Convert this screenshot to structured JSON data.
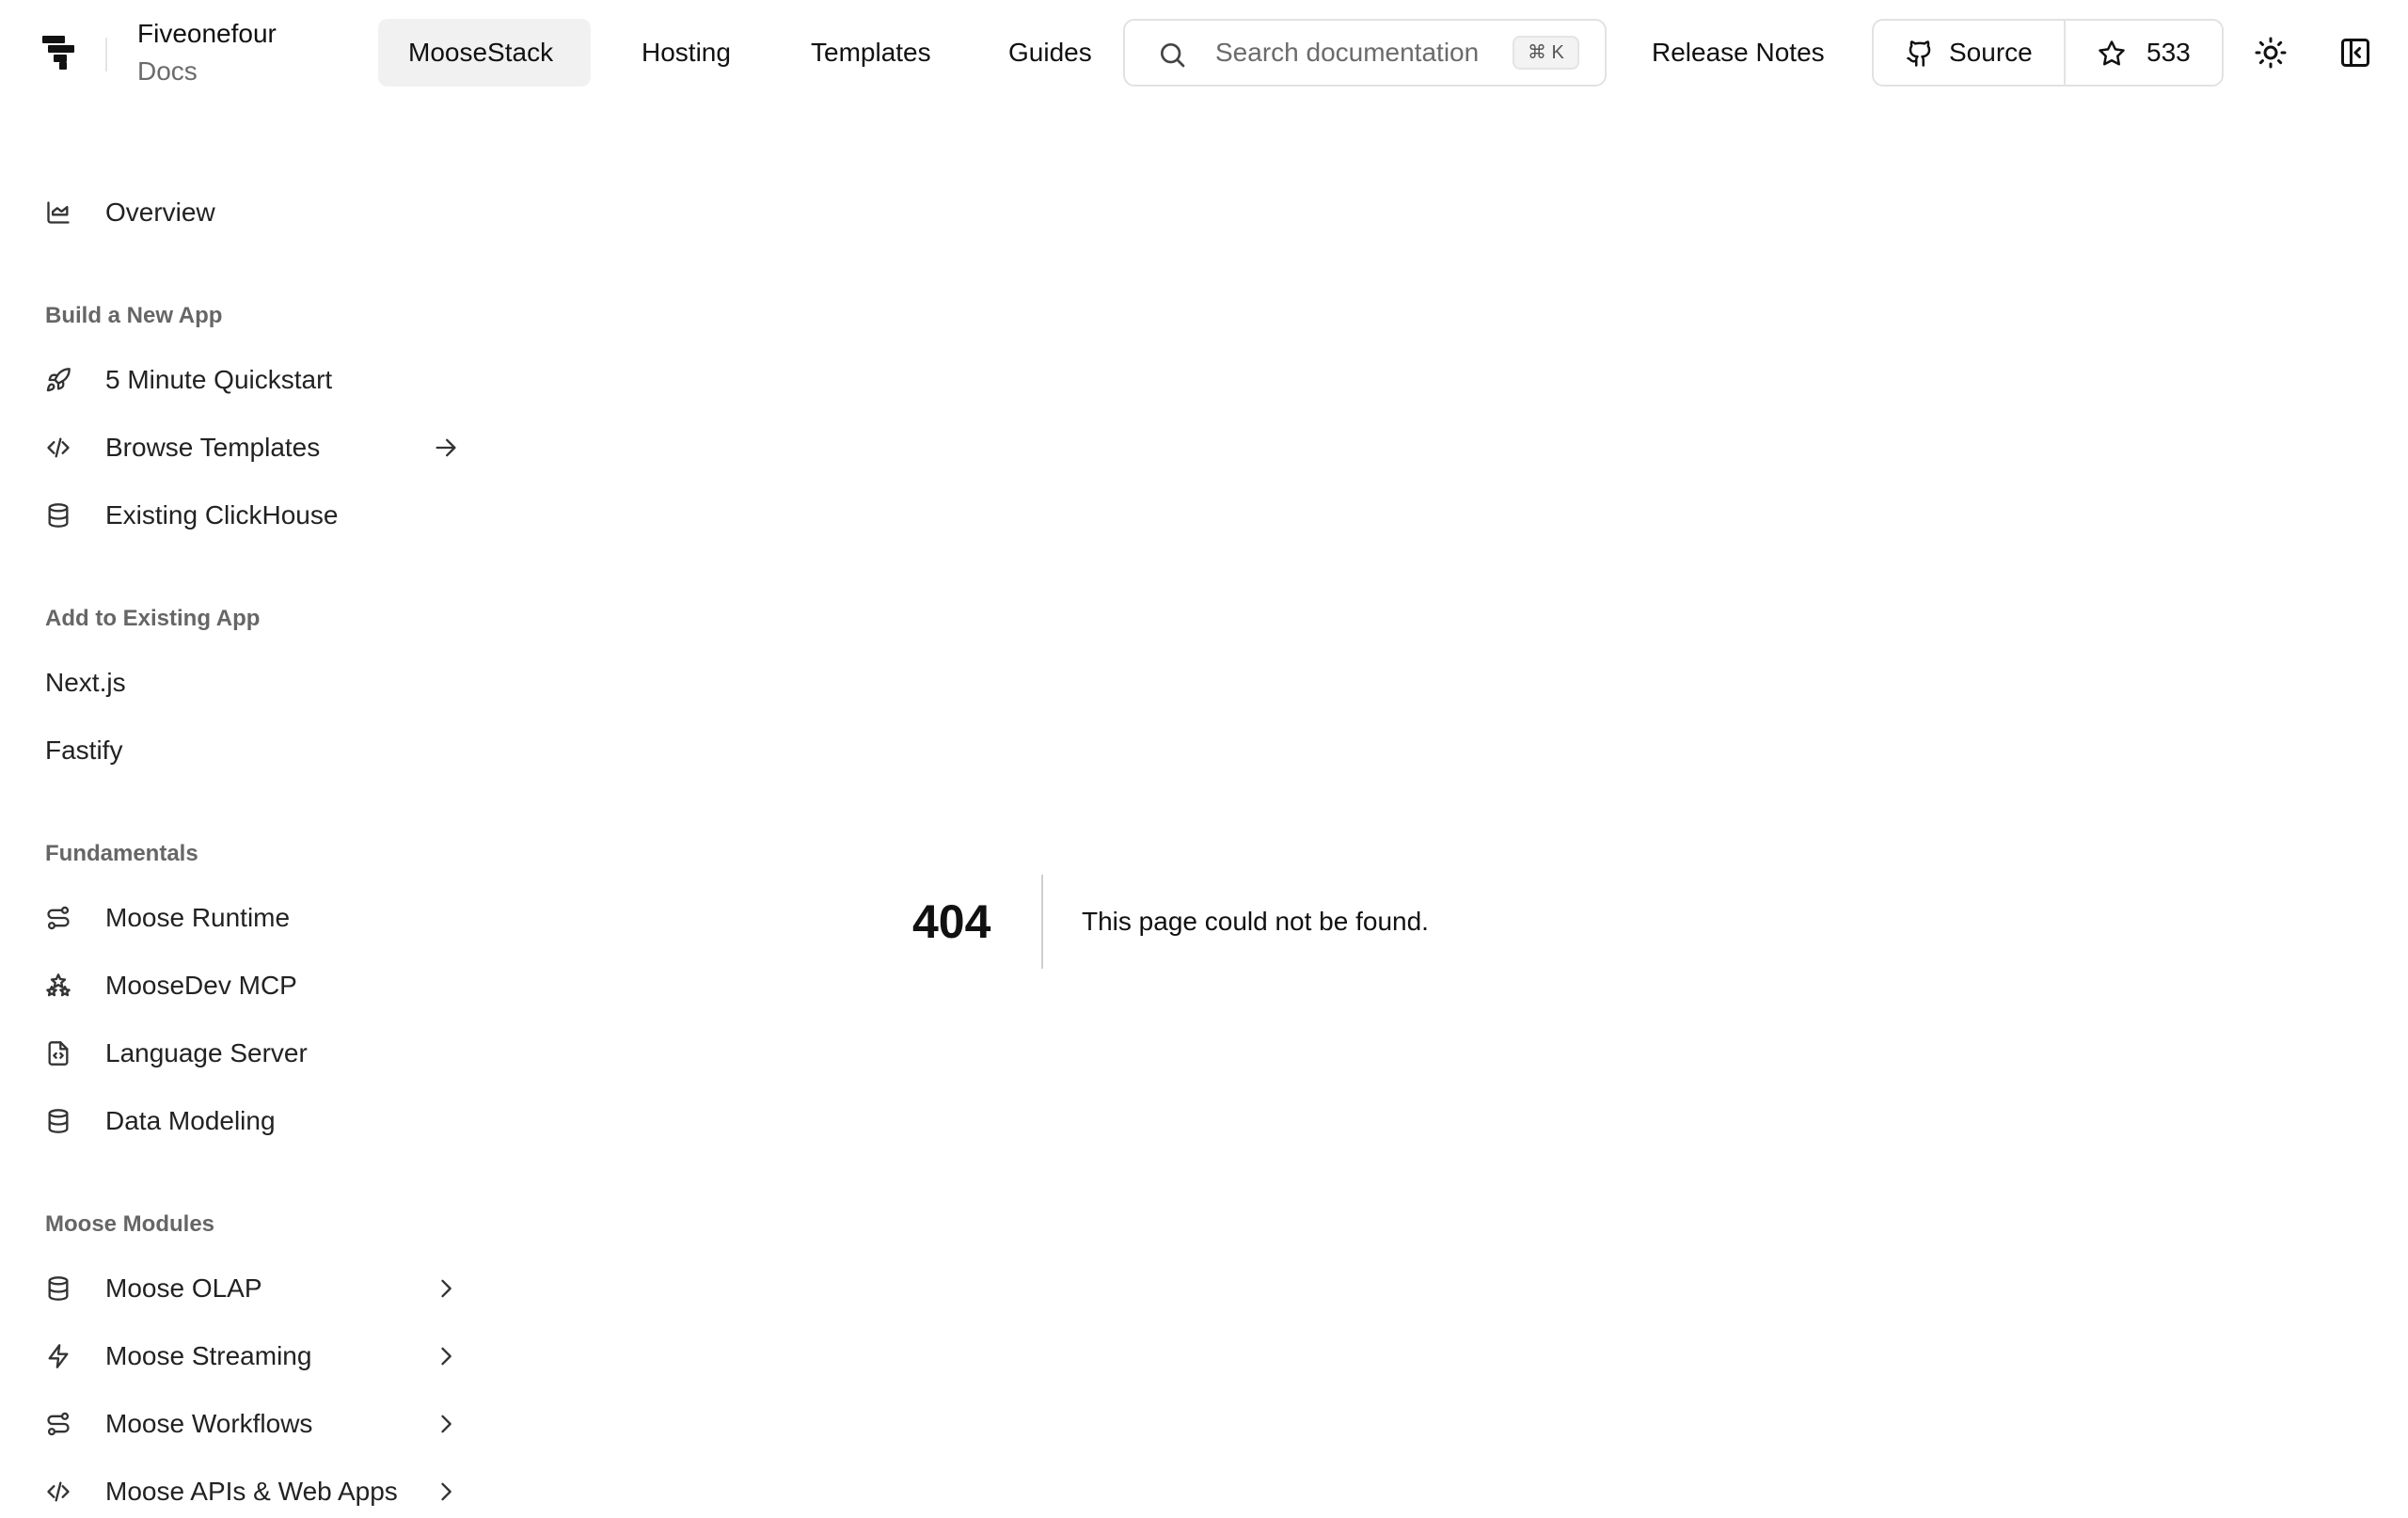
{
  "brand": {
    "name": "Fiveonefour",
    "sub": "Docs"
  },
  "nav": {
    "moosestack": "MooseStack",
    "hosting": "Hosting",
    "templates": "Templates",
    "guides": "Guides",
    "release_notes": "Release Notes"
  },
  "search": {
    "placeholder": "Search documentation",
    "shortcut": "⌘ K"
  },
  "github": {
    "source_label": "Source",
    "stars": "533"
  },
  "sidebar": {
    "overview": "Overview",
    "sections": [
      {
        "heading": "Build a New App",
        "items": [
          "5 Minute Quickstart",
          "Browse Templates",
          "Existing ClickHouse"
        ]
      },
      {
        "heading": "Add to Existing App",
        "items": [
          "Next.js",
          "Fastify"
        ]
      },
      {
        "heading": "Fundamentals",
        "items": [
          "Moose Runtime",
          "MooseDev MCP",
          "Language Server",
          "Data Modeling"
        ]
      },
      {
        "heading": "Moose Modules",
        "items": [
          "Moose OLAP",
          "Moose Streaming",
          "Moose Workflows",
          "Moose APIs & Web Apps"
        ]
      }
    ]
  },
  "error": {
    "code": "404",
    "message": "This page could not be found."
  },
  "icons": {
    "overview": "chart-area-icon",
    "quickstart": "rocket-icon",
    "templates": "code-icon",
    "clickhouse": "database-icon",
    "runtime": "route-icon",
    "mcp": "sparkles-icon",
    "lsp": "file-code-icon",
    "modeling": "database-icon",
    "olap": "database-icon",
    "streaming": "zap-icon",
    "workflows": "route-icon",
    "apis": "code-icon"
  },
  "colors": {
    "nav_active_bg": "#f1f1f1",
    "border": "#e2e2e2",
    "muted_text": "#6b6b6b"
  }
}
